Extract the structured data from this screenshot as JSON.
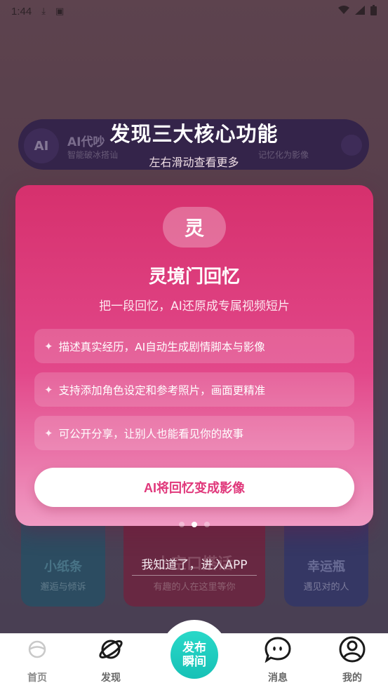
{
  "status_bar": {
    "time": "1:44"
  },
  "background": {
    "pill": {
      "left_badge": "AI",
      "left_title": "AI代吵",
      "left_sub": "智能破冰搭讪",
      "right_sub": "记忆化为影像"
    },
    "cards": [
      {
        "title": "小纸条",
        "sub": "邂逅与倾诉"
      },
      {
        "title": "上空口搭话",
        "sub": "有趣的人在这里等你"
      },
      {
        "title": "幸运瓶",
        "sub": "遇见对的人"
      }
    ]
  },
  "dialog": {
    "title": "发现三大核心功能",
    "subtitle": "左右滑动查看更多",
    "card": {
      "badge": "灵",
      "title": "灵境门回忆",
      "desc": "把一段回忆，AI还原成专属视频短片",
      "bullets": [
        "描述真实经历，AI自动生成剧情脚本与影像",
        "支持添加角色设定和参考照片，画面更精准",
        "可公开分享，让别人也能看见你的故事"
      ],
      "cta": "AI将回忆变成影像"
    },
    "page_indicator": {
      "total": 3,
      "active": 2
    },
    "dismiss": "我知道了，进入APP"
  },
  "bottom_nav": {
    "items": [
      {
        "label": "首页",
        "icon": "home-ring-icon"
      },
      {
        "label": "发现",
        "icon": "planet-icon"
      },
      {
        "label": "消息",
        "icon": "chat-bubble-icon"
      },
      {
        "label": "我的",
        "icon": "user-icon"
      }
    ],
    "publish": {
      "line1": "发布",
      "line2": "瞬间"
    }
  },
  "colors": {
    "accent_pink": "#e0387b",
    "publish_teal": "#1fcfc0"
  }
}
